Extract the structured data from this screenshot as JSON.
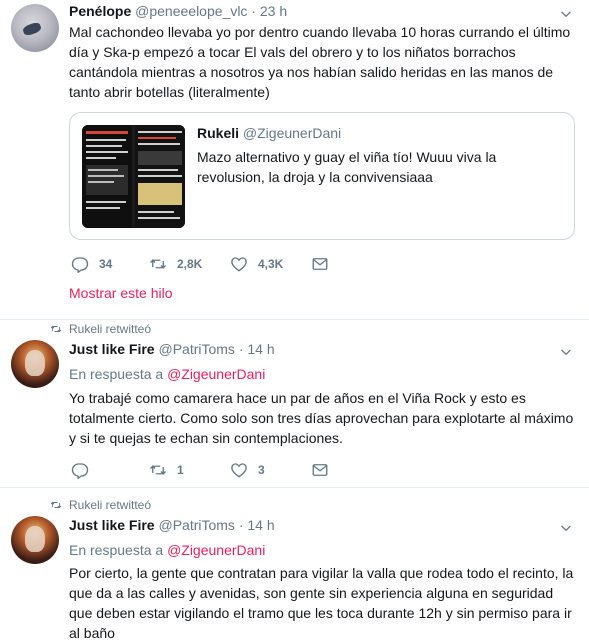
{
  "tweets": [
    {
      "name": "Penélope",
      "handle": "@peneeelope_vlc",
      "sep": "·",
      "time": "23 h",
      "text": "Mal cachondeo llevaba yo por dentro cuando llevaba 10 horas currando el último día y Ska-p empezó a tocar El vals del obrero y to los niñatos borrachos cantándola mientras a nosotros ya nos habían salido heridas en las manos de tanto abrir botellas (literalmente)",
      "quote": {
        "name": "Rukeli",
        "handle": "@ZigeunerDani",
        "text": "Mazo alternativo y guay el viña tío! Wuuu viva la revolusion, la droja y la convivensiaaa"
      },
      "actions": {
        "replies": "34",
        "retweets": "2,8K",
        "likes": "4,3K"
      },
      "show_thread": "Mostrar este hilo"
    },
    {
      "context": "Rukeli retwitteó",
      "name": "Just like Fire",
      "handle": "@PatriToms",
      "sep": "·",
      "time": "14 h",
      "reply_prefix": "En respuesta a",
      "reply_handle": "@ZigeunerDani",
      "text": "Yo trabajé como camarera hace un par de años en el Viña Rock y esto es totalmente cierto. Como solo son tres días aprovechan para explotarte al máximo y si te quejas te echan sin contemplaciones.",
      "actions": {
        "replies": "",
        "retweets": "1",
        "likes": "3"
      }
    },
    {
      "context": "Rukeli retwitteó",
      "name": "Just like Fire",
      "handle": "@PatriToms",
      "sep": "·",
      "time": "14 h",
      "reply_prefix": "En respuesta a",
      "reply_handle": "@ZigeunerDani",
      "text": "Por cierto, la gente que contratan para vigilar la valla que rodea todo el recinto, la que da a las calles y avenidas, son gente sin experiencia alguna en seguridad que deben estar vigilando el tramo que les toca durante 12h y sin permiso para ir al baño"
    }
  ],
  "icons": {
    "reply": "reply-icon",
    "retweet": "retweet-icon",
    "like": "heart-icon",
    "dm": "envelope-icon",
    "more": "chevron-down-icon",
    "retweet_context": "retweet-icon"
  },
  "colors": {
    "accent": "#e0245e",
    "text": "#14171a",
    "secondary": "#657786",
    "border": "#e6ecf0"
  }
}
